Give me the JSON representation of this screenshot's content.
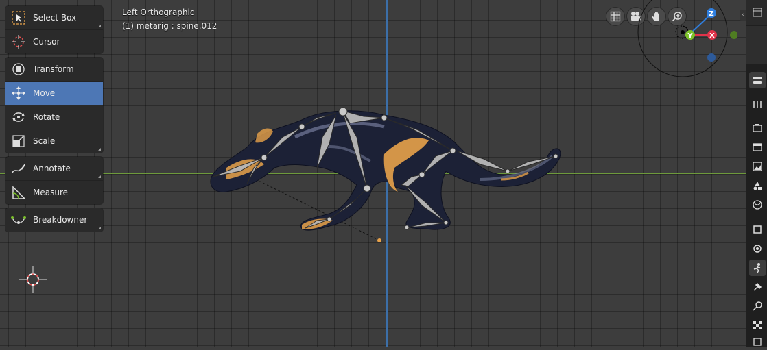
{
  "viewport": {
    "view_name": "Left Orthographic",
    "object_info": "(1) metarig : spine.012"
  },
  "toolbar": {
    "groups": [
      [
        {
          "label": "Select Box",
          "icon": "select-box-icon"
        },
        {
          "label": "Cursor",
          "icon": "cursor-icon"
        }
      ],
      [
        {
          "label": "Transform",
          "icon": "transform-icon"
        },
        {
          "label": "Move",
          "icon": "move-icon",
          "active": true
        },
        {
          "label": "Rotate",
          "icon": "rotate-icon"
        },
        {
          "label": "Scale",
          "icon": "scale-icon"
        }
      ],
      [
        {
          "label": "Annotate",
          "icon": "annotate-icon"
        },
        {
          "label": "Measure",
          "icon": "measure-icon"
        }
      ],
      [
        {
          "label": "Breakdowner",
          "icon": "breakdowner-icon"
        }
      ]
    ]
  },
  "navigation": {
    "buttons": [
      "grid-view-icon",
      "camera-icon",
      "hand-pan-icon",
      "zoom-icon"
    ]
  },
  "gizmo": {
    "axes": [
      {
        "label": "Z",
        "color": "#2f7fe0"
      },
      {
        "label": "Y",
        "color": "#7cc12a"
      },
      {
        "label": "X",
        "color": "#e0334a"
      }
    ]
  },
  "colors": {
    "active_tool": "#4d77b5",
    "z_axis_line": "#3c6fa8",
    "y_axis_line": "#6e9a3c",
    "bone_color": "#b8b8b8",
    "accent_orange": "#e8a24a"
  },
  "sidebar": {
    "tabs": [
      "tool-icon",
      "render-icon",
      "output-icon",
      "view-layer-icon",
      "scene-icon",
      "world-icon",
      "object-icon",
      "modifier-icon",
      "particles-icon",
      "physics-icon",
      "constraints-icon",
      "data-icon",
      "texture-icon"
    ]
  }
}
